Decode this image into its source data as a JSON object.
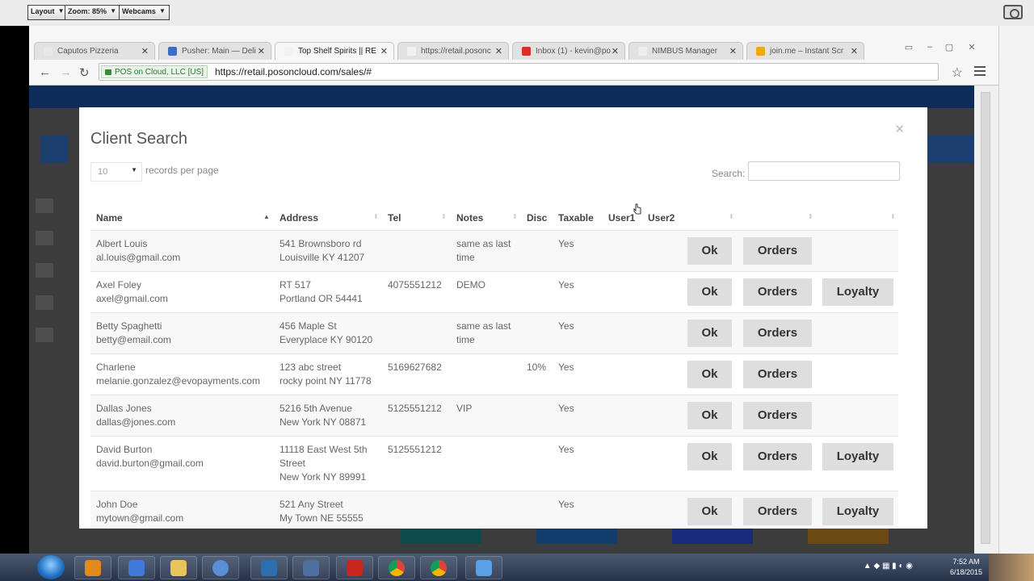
{
  "share_toolbar": {
    "layout": "Layout",
    "zoom": "Zoom: 85%",
    "webcams": "Webcams"
  },
  "browser": {
    "tabs": [
      {
        "label": "Caputos Pizzeria",
        "favicon_color": "#e8e8e8"
      },
      {
        "label": "Pusher: Main — Deli",
        "favicon_color": "#3a6fc4"
      },
      {
        "label": "Top Shelf Spirits || RE",
        "favicon_color": "#f2f2f2",
        "active": true
      },
      {
        "label": "https://retail.posonc",
        "favicon_color": "#f2f2f2"
      },
      {
        "label": "Inbox (1) - kevin@po",
        "favicon_color": "#d93025"
      },
      {
        "label": "NIMBUS Manager",
        "favicon_color": "#eeeeee"
      },
      {
        "label": "join.me – Instant Scr",
        "favicon_color": "#f3a712"
      }
    ],
    "ssl_label": "POS on Cloud, LLC [US]",
    "url": "https://retail.posoncloud.com/sales/#"
  },
  "modal": {
    "title": "Client Search",
    "page_length": "10",
    "page_length_label": "records per page",
    "search_label": "Search:",
    "search_value": "",
    "columns": [
      "Name",
      "Address",
      "Tel",
      "Notes",
      "Disc",
      "Taxable",
      "User1",
      "User2"
    ],
    "ok_label": "Ok",
    "orders_label": "Orders",
    "loyalty_label": "Loyalty",
    "rows": [
      {
        "name": "Albert Louis",
        "email": "al.louis@gmail.com",
        "addr1": "541 Brownsboro rd",
        "addr2": "Louisville KY 41207",
        "addr3": "",
        "tel": "",
        "notes1": "same as last",
        "notes2": "time",
        "disc": "",
        "taxable": "Yes",
        "loyalty": false
      },
      {
        "name": "Axel Foley",
        "email": "axel@gmail.com",
        "addr1": "RT 517",
        "addr2": "Portland OR 54441",
        "addr3": "",
        "tel": "4075551212",
        "notes1": "DEMO",
        "notes2": "",
        "disc": "",
        "taxable": "Yes",
        "loyalty": true
      },
      {
        "name": "Betty Spaghetti",
        "email": "betty@email.com",
        "addr1": "456 Maple St",
        "addr2": "Everyplace KY 90120",
        "addr3": "",
        "tel": "",
        "notes1": "same as last",
        "notes2": "time",
        "disc": "",
        "taxable": "Yes",
        "loyalty": false
      },
      {
        "name": "Charlene",
        "email": "melanie.gonzalez@evopayments.com",
        "addr1": "123 abc street",
        "addr2": "rocky point NY 11778",
        "addr3": "",
        "tel": "5169627682",
        "notes1": "",
        "notes2": "",
        "disc": "10%",
        "taxable": "Yes",
        "loyalty": false
      },
      {
        "name": "Dallas Jones",
        "email": "dallas@jones.com",
        "addr1": "5216 5th Avenue",
        "addr2": "New York NY 08871",
        "addr3": "",
        "tel": "5125551212",
        "notes1": "VIP",
        "notes2": "",
        "disc": "",
        "taxable": "Yes",
        "loyalty": false
      },
      {
        "name": "David Burton",
        "email": "david.burton@gmail.com",
        "addr1": "11118 East West 5th",
        "addr2": "Street",
        "addr3": "New York NY 89991",
        "tel": "5125551212",
        "notes1": "",
        "notes2": "",
        "disc": "",
        "taxable": "Yes",
        "loyalty": true
      },
      {
        "name": "John Doe",
        "email": "mytown@gmail.com",
        "addr1": "521 Any Street",
        "addr2": "My Town NE 55555",
        "addr3": "",
        "tel": "",
        "notes1": "",
        "notes2": "",
        "disc": "",
        "taxable": "Yes",
        "loyalty": true
      }
    ]
  },
  "taskbar": {
    "time": "7:52 AM",
    "date": "6/18/2015",
    "icons": [
      "media-player-icon",
      "app-store-icon",
      "file-explorer-icon",
      "globe-icon",
      "remote-desktop-icon",
      "network-icon",
      "filezilla-icon",
      "chrome-icon",
      "chrome-icon-2",
      "snowflake-icon"
    ]
  },
  "colors": {
    "accent_nav": "#0e2c5a",
    "button_bg": "#dedede",
    "ssl_green": "#2b7a2b"
  }
}
